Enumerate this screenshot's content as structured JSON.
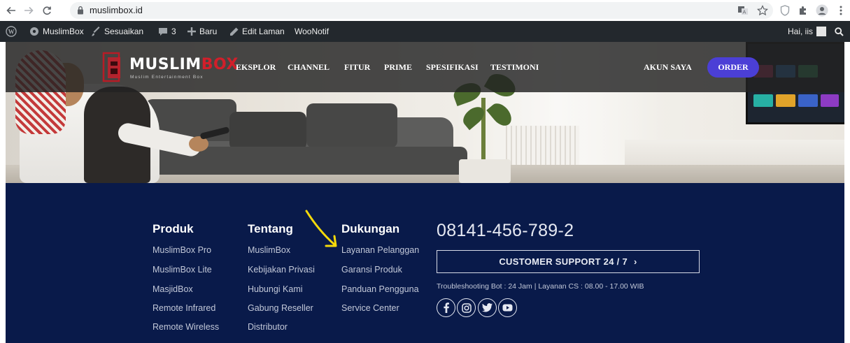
{
  "browser": {
    "url": "muslimbox.id"
  },
  "adminbar": {
    "site_name": "MuslimBox",
    "customize": "Sesuaikan",
    "comments_count": "3",
    "new": "Baru",
    "edit_page": "Edit Laman",
    "woonotif": "WooNotif",
    "greeting": "Hai, iis"
  },
  "header": {
    "logo_main": "MUSLIM",
    "logo_accent": "BOX",
    "logo_tagline": "Muslim Entertainment Box",
    "nav": [
      "EKSPLOR",
      "CHANNEL",
      "FITUR",
      "PRIME",
      "SPESIFIKASI",
      "TESTIMONI"
    ],
    "account": "AKUN SAYA",
    "order": "ORDER"
  },
  "footer": {
    "columns": [
      {
        "title": "Produk",
        "links": [
          "MuslimBox Pro",
          "MuslimBox Lite",
          "MasjidBox",
          "Remote Infrared",
          "Remote Wireless"
        ]
      },
      {
        "title": "Tentang",
        "links": [
          "MuslimBox",
          "Kebijakan Privasi",
          "Hubungi Kami",
          "Gabung Reseller",
          "Distributor"
        ]
      },
      {
        "title": "Dukungan",
        "links": [
          "Layanan Pelanggan",
          "Garansi Produk",
          "Panduan Pengguna",
          "Service Center"
        ]
      }
    ],
    "phone": "08141-456-789-2",
    "support_button": "CUSTOMER SUPPORT 24 / 7",
    "support_chevron": "›",
    "hours_note": "Troubleshooting Bot : 24 Jam | Layanan CS : 08.00 - 17.00 WIB",
    "social": [
      "facebook-icon",
      "instagram-icon",
      "twitter-icon",
      "youtube-icon"
    ]
  },
  "colors": {
    "footer_bg": "#091a4a",
    "admin_bar": "#23282d",
    "order_button": "#4b3fd6",
    "logo_red": "#d11f2a",
    "annotation_arrow": "#f5d90a"
  }
}
